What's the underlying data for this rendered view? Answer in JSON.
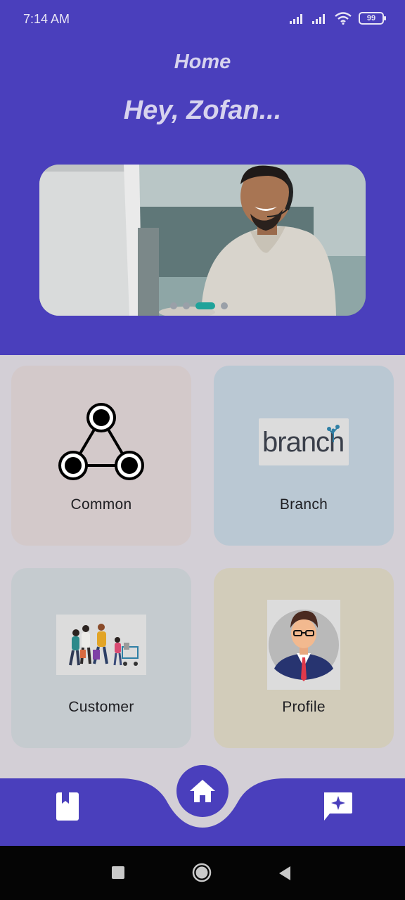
{
  "status": {
    "time": "7:14 AM",
    "battery": "99"
  },
  "header": {
    "title": "Home",
    "greeting": "Hey, Zofan..."
  },
  "carousel": {
    "dots": 4,
    "active_index": 2
  },
  "cards": [
    {
      "label": "Common",
      "icon": "network-triangle-icon"
    },
    {
      "label": "Branch",
      "icon": "branch-logo",
      "logo_text": "branch"
    },
    {
      "label": "Customer",
      "icon": "customers-illustration"
    },
    {
      "label": "Profile",
      "icon": "profile-avatar"
    }
  ],
  "nav": {
    "left_icon": "bookmark-book-icon",
    "center_icon": "home-icon",
    "right_icon": "feedback-star-icon"
  },
  "colors": {
    "primary": "#4a3fbc",
    "accent": "#1fa39a",
    "background": "#d3cfd6"
  }
}
